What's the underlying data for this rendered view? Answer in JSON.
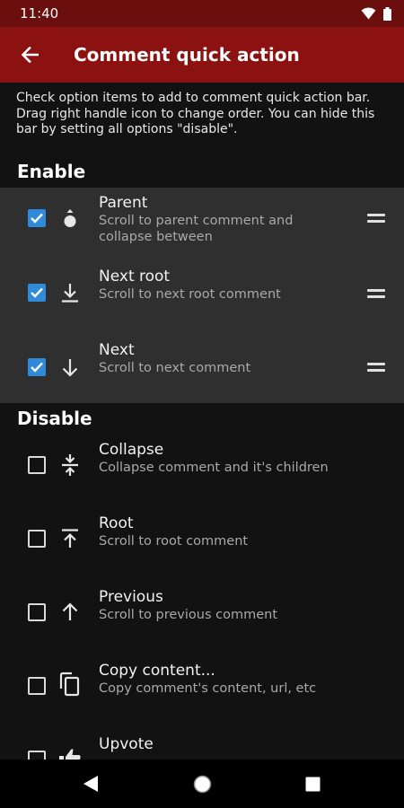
{
  "status_bar": {
    "time": "11:40"
  },
  "app_bar": {
    "title": "Comment quick action"
  },
  "intro": "Check option items to add to comment quick action bar. Drag right handle icon to change order. You can hide this bar by setting all options \"disable\".",
  "sections": {
    "enable": "Enable",
    "disable": "Disable"
  },
  "enabled_items": [
    {
      "title": "Parent",
      "subtitle": "Scroll to parent comment and collapse between",
      "icon": "parent-scroll-icon",
      "checked": true
    },
    {
      "title": "Next root",
      "subtitle": "Scroll to next root comment",
      "icon": "arrow-down-to-bar-icon",
      "checked": true
    },
    {
      "title": "Next",
      "subtitle": "Scroll to next comment",
      "icon": "arrow-down-icon",
      "checked": true
    }
  ],
  "disabled_items": [
    {
      "title": "Collapse",
      "subtitle": "Collapse comment and it's children",
      "icon": "collapse-icon",
      "checked": false
    },
    {
      "title": "Root",
      "subtitle": "Scroll to root comment",
      "icon": "arrow-up-to-bar-icon",
      "checked": false
    },
    {
      "title": "Previous",
      "subtitle": "Scroll to previous comment",
      "icon": "arrow-up-icon",
      "checked": false
    },
    {
      "title": "Copy content...",
      "subtitle": "Copy comment's content, url, etc",
      "icon": "copy-icon",
      "checked": false
    },
    {
      "title": "Upvote",
      "subtitle": "",
      "icon": "thumbs-up-icon",
      "checked": false
    }
  ],
  "colors": {
    "app_bar": "#8c1111",
    "status_bar": "#6a0e0e",
    "checkbox": "#2f8bd9",
    "background": "#121212",
    "enabled_bg": "#2f2f2f"
  }
}
